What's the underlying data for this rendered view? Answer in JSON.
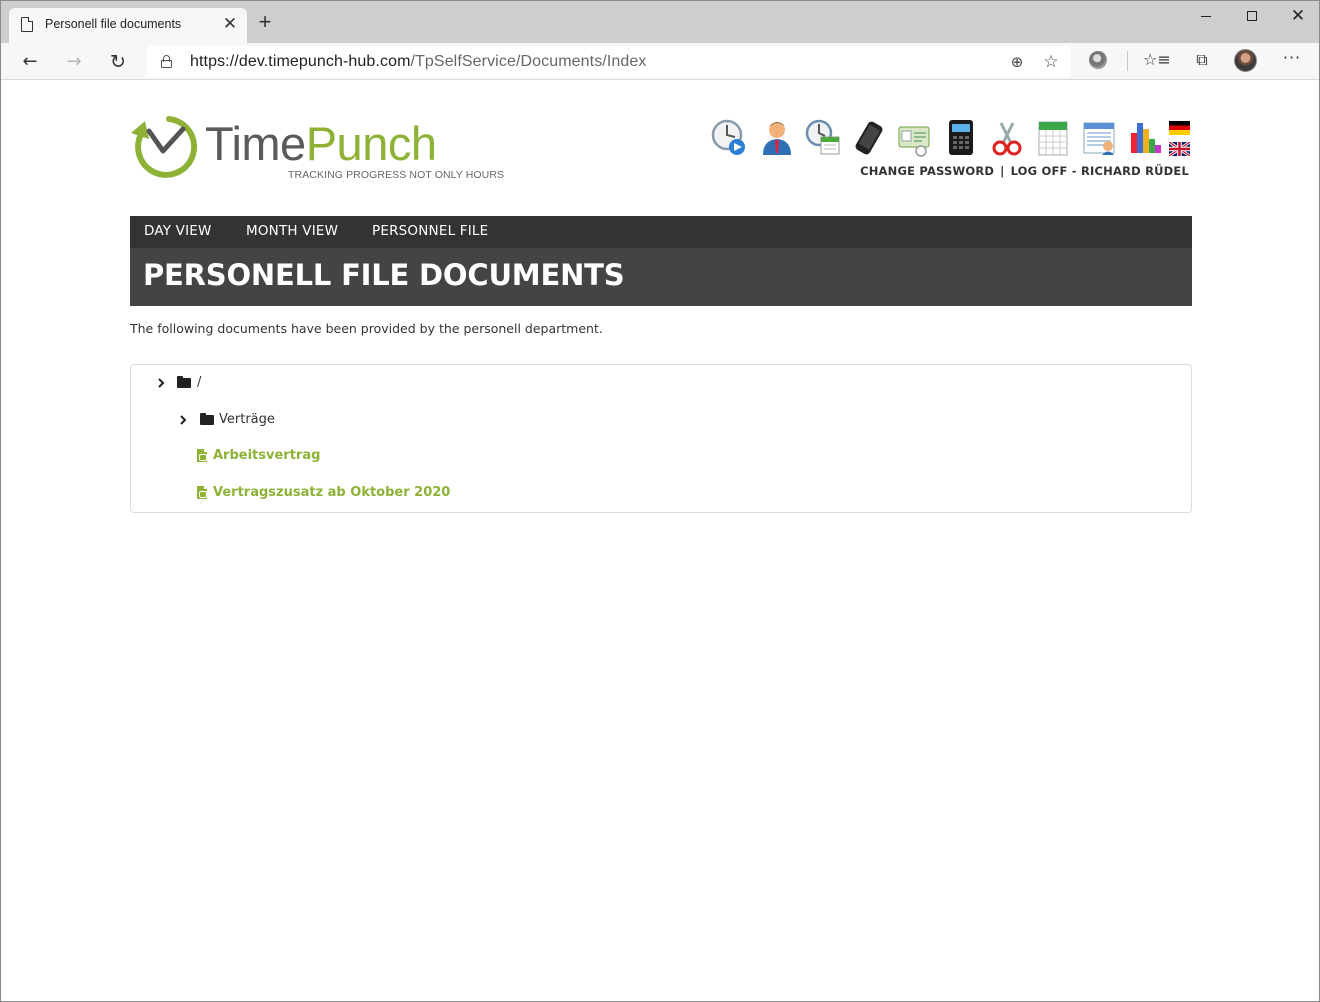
{
  "browser": {
    "tab_title": "Personell file documents",
    "tab_close": "✕",
    "new_tab": "+",
    "win_close": "✕",
    "url_host": "https://dev.timepunch-hub.com",
    "url_path": "/TpSelfService/Documents/Index",
    "icons": {
      "back": "←",
      "forward": "→",
      "reload": "↻",
      "zoom": "⊕",
      "star": "☆",
      "favorites": "☆≡",
      "collections": "⧉",
      "more": "···"
    }
  },
  "logo": {
    "word_part1": "Time",
    "word_part2": "Punch",
    "tagline": "TRACKING PROGRESS NOT ONLY HOURS",
    "colors": {
      "gray": "#5a5a5a",
      "green": "#8eb236"
    }
  },
  "app_icons": [
    "clock-play-icon",
    "employee-icon",
    "time-calendar-icon",
    "phone-icon",
    "id-card-icon",
    "terminal-icon",
    "scissors-icon",
    "calendar-icon",
    "schedule-icon",
    "chart-icon"
  ],
  "flags": [
    "de",
    "uk"
  ],
  "account": {
    "change_password": "CHANGE PASSWORD",
    "separator": "|",
    "logoff": "LOG OFF - RICHARD RÜDEL"
  },
  "nav": {
    "items": [
      {
        "label": "DAY VIEW"
      },
      {
        "label": "MONTH VIEW"
      },
      {
        "label": "PERSONNEL FILE"
      }
    ]
  },
  "page": {
    "title": "PERSONELL FILE DOCUMENTS",
    "intro": "The following documents have been provided by the personell department."
  },
  "tree": {
    "root": {
      "label": "/"
    },
    "folder": {
      "label": "Verträge"
    },
    "documents": [
      {
        "label": "Arbeitsvertrag"
      },
      {
        "label": "Vertragszusatz ab Oktober 2020"
      }
    ]
  }
}
